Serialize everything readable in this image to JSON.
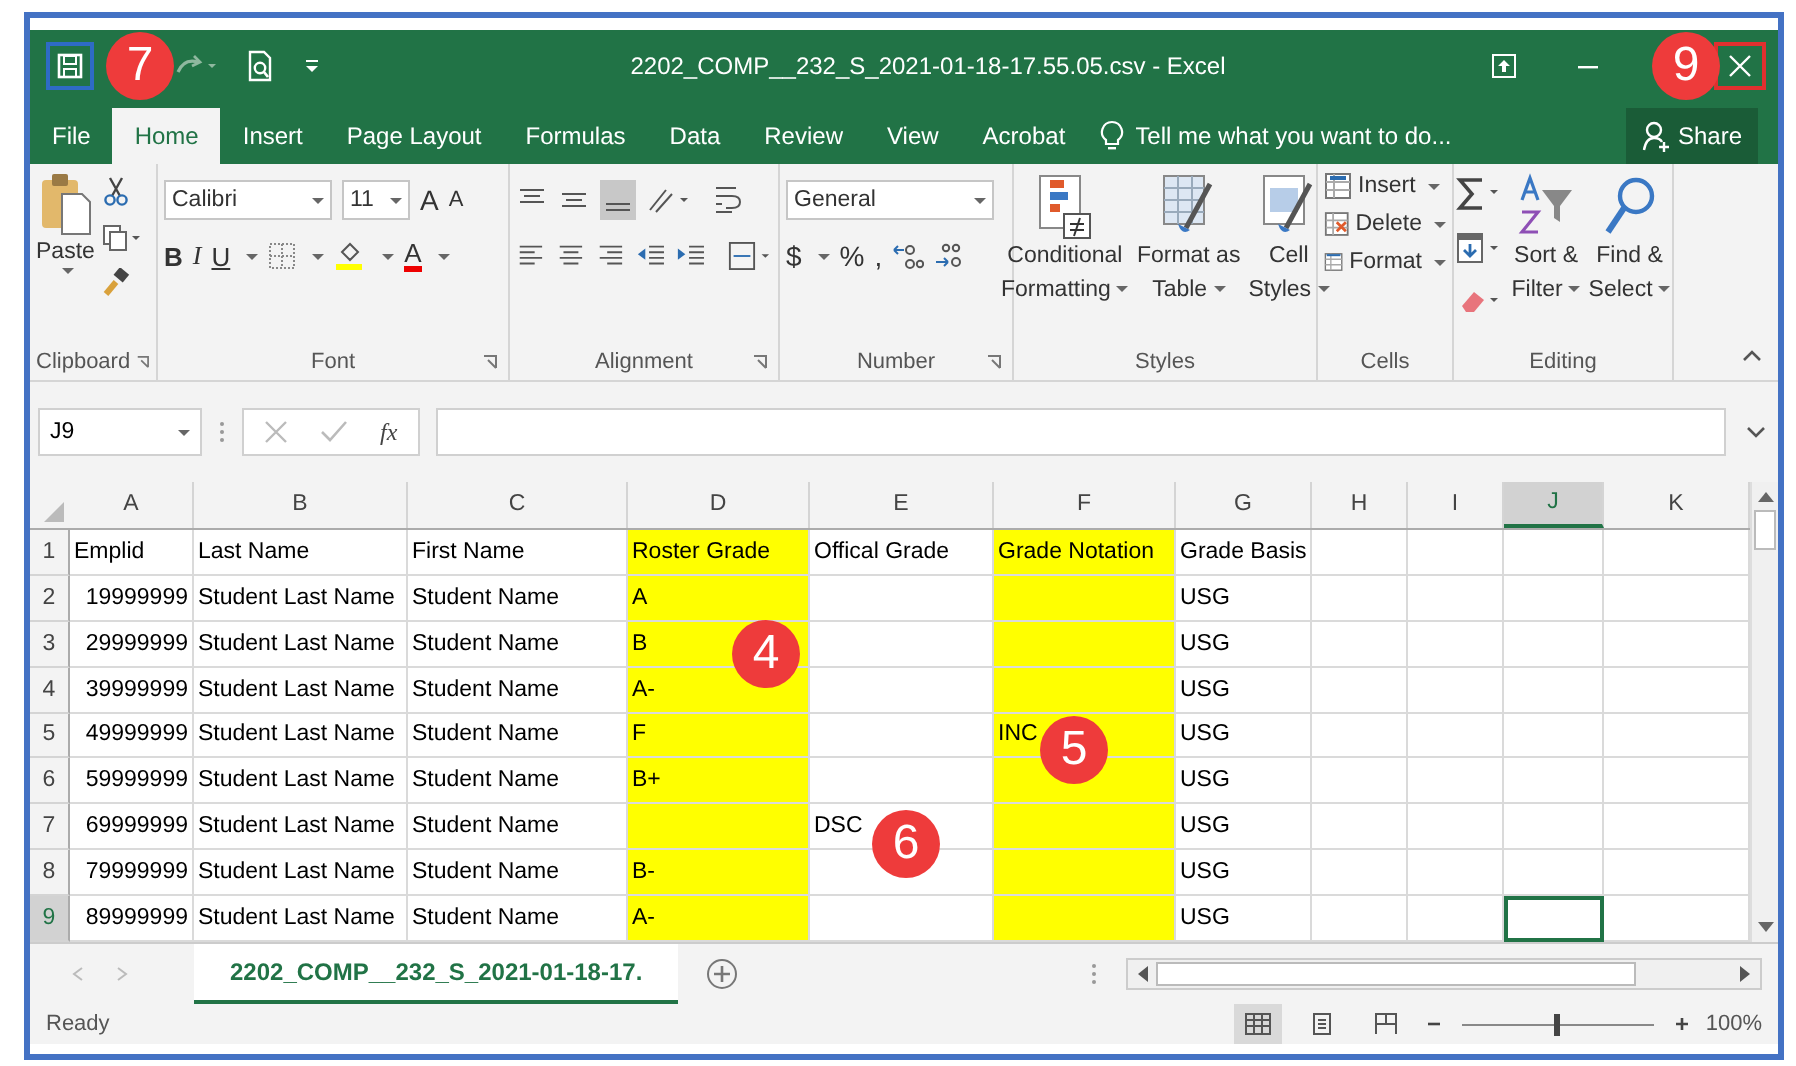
{
  "window": {
    "title": "2202_COMP__232_S_2021-01-18-17.55.05.csv - Excel"
  },
  "ribbon_tabs": [
    {
      "label": "File",
      "selected": false
    },
    {
      "label": "Home",
      "selected": true
    },
    {
      "label": "Insert",
      "selected": false
    },
    {
      "label": "Page Layout",
      "selected": false
    },
    {
      "label": "Formulas",
      "selected": false
    },
    {
      "label": "Data",
      "selected": false
    },
    {
      "label": "Review",
      "selected": false
    },
    {
      "label": "View",
      "selected": false
    },
    {
      "label": "Acrobat",
      "selected": false
    }
  ],
  "tell_me": {
    "placeholder": "Tell me what you want to do..."
  },
  "share": "Share",
  "ribbon": {
    "paste": "Paste",
    "font_name": "Calibri",
    "font_size": "11",
    "grow_font": "A",
    "shrink_font": "A",
    "bold": "B",
    "italic": "I",
    "underline": "U",
    "font_color": "A",
    "number_format": "General",
    "currency": "$",
    "percent": "%",
    "comma": ",",
    "styles": [
      {
        "line1": "Conditional",
        "line2": "Formatting"
      },
      {
        "line1": "Format as",
        "line2": "Table"
      },
      {
        "line1": "Cell",
        "line2": "Styles"
      }
    ],
    "cells": [
      "Insert",
      "Delete",
      "Format"
    ],
    "editing": [
      {
        "line1": "Sort &",
        "line2": "Filter"
      },
      {
        "line1": "Find &",
        "line2": "Select"
      }
    ],
    "groups": [
      "Clipboard",
      "Font",
      "Alignment",
      "Number",
      "Styles",
      "Cells",
      "Editing"
    ]
  },
  "formula_bar": {
    "name_box": "J9",
    "function_label": "fx"
  },
  "columns": [
    {
      "letter": "A",
      "highlighted": false,
      "selected": false
    },
    {
      "letter": "B",
      "highlighted": false,
      "selected": false
    },
    {
      "letter": "C",
      "highlighted": false,
      "selected": false
    },
    {
      "letter": "D",
      "highlighted": true,
      "selected": false
    },
    {
      "letter": "E",
      "highlighted": false,
      "selected": false
    },
    {
      "letter": "F",
      "highlighted": true,
      "selected": false
    },
    {
      "letter": "G",
      "highlighted": false,
      "selected": false
    },
    {
      "letter": "H",
      "highlighted": false,
      "selected": false
    },
    {
      "letter": "I",
      "highlighted": false,
      "selected": false
    },
    {
      "letter": "J",
      "highlighted": false,
      "selected": true
    },
    {
      "letter": "K",
      "highlighted": false,
      "selected": false
    }
  ],
  "rows": [
    {
      "number": "1",
      "selected": false,
      "cells": [
        "Emplid",
        "Last Name",
        "First Name",
        "Roster Grade",
        "Offical Grade",
        "Grade Notation",
        "Grade Basis"
      ]
    },
    {
      "number": "2",
      "selected": false,
      "cells": [
        "19999999",
        "Student Last Name",
        "Student Name",
        "A",
        null,
        null,
        "USG"
      ]
    },
    {
      "number": "3",
      "selected": false,
      "cells": [
        "29999999",
        "Student Last Name",
        "Student Name",
        "B",
        null,
        null,
        "USG"
      ]
    },
    {
      "number": "4",
      "selected": false,
      "cells": [
        "39999999",
        "Student Last Name",
        "Student Name",
        "A-",
        null,
        null,
        "USG"
      ]
    },
    {
      "number": "5",
      "selected": false,
      "cells": [
        "49999999",
        "Student Last Name",
        "Student Name",
        "F",
        null,
        "INC",
        "USG"
      ]
    },
    {
      "number": "6",
      "selected": false,
      "cells": [
        "59999999",
        "Student Last Name",
        "Student Name",
        "B+",
        null,
        null,
        "USG"
      ]
    },
    {
      "number": "7",
      "selected": false,
      "cells": [
        "69999999",
        "Student Last Name",
        "Student Name",
        null,
        "DSC",
        null,
        "USG"
      ]
    },
    {
      "number": "8",
      "selected": false,
      "cells": [
        "79999999",
        "Student Last Name",
        "Student Name",
        "B-",
        null,
        null,
        "USG"
      ]
    },
    {
      "number": "9",
      "selected": true,
      "cells": [
        "89999999",
        "Student Last Name",
        "Student Name",
        "A-",
        null,
        null,
        "USG"
      ]
    }
  ],
  "sheet_tabs": [
    {
      "label": "2202_COMP__232_S_2021-01-18-17.",
      "selected": true
    }
  ],
  "status_bar": {
    "status": "Ready",
    "zoom": {
      "level": 0.5,
      "reading": "100%"
    }
  },
  "callouts": [
    {
      "number": "7"
    },
    {
      "number": "9"
    },
    {
      "number": "4"
    },
    {
      "number": "5"
    },
    {
      "number": "6"
    }
  ]
}
